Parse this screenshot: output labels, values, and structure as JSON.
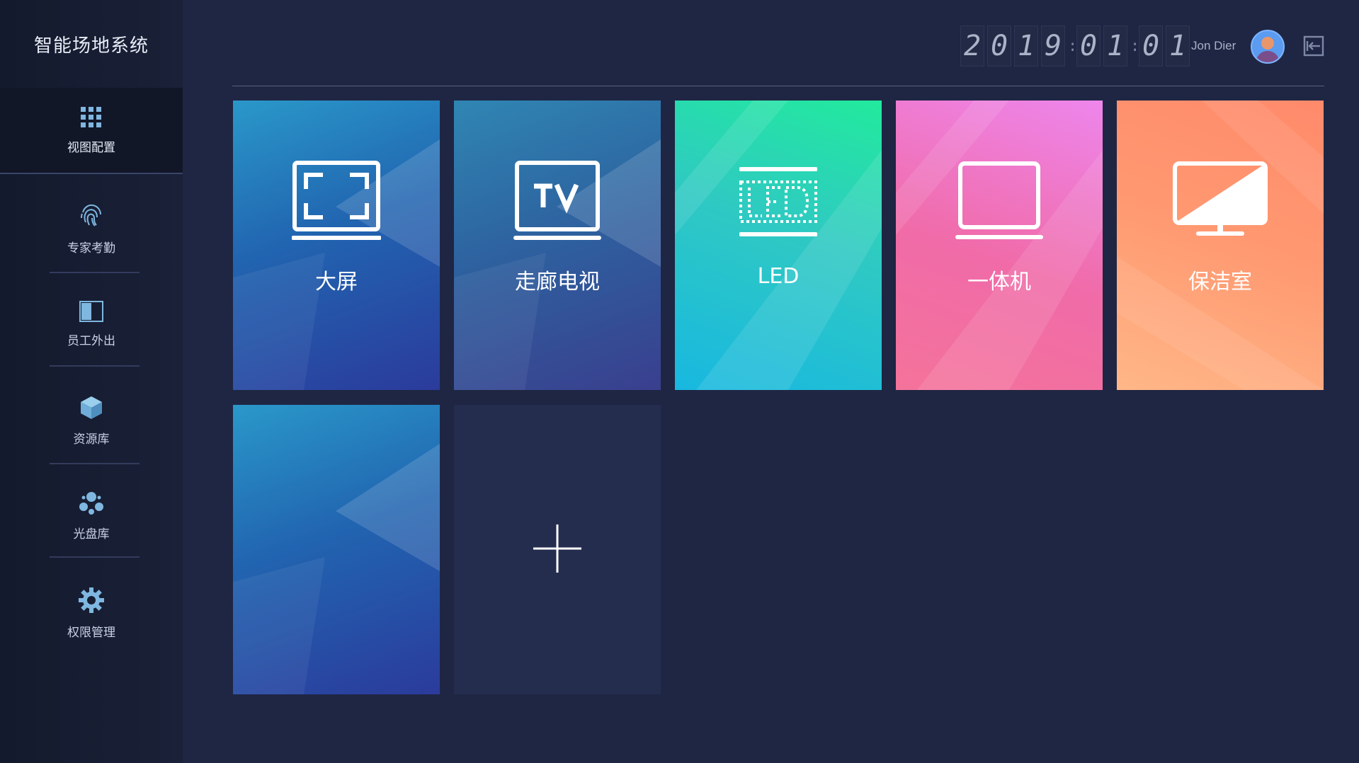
{
  "app": {
    "title": "智能场地系统"
  },
  "sidebar": {
    "items": [
      {
        "label": "视图配置",
        "icon": "grid-icon",
        "active": true
      },
      {
        "label": "专家考勤",
        "icon": "fingerprint-icon"
      },
      {
        "label": "员工外出",
        "icon": "half-square-icon"
      },
      {
        "label": "资源库",
        "icon": "cube-icon"
      },
      {
        "label": "光盘库",
        "icon": "cluster-icon"
      },
      {
        "label": "权限管理",
        "icon": "gear-icon"
      }
    ]
  },
  "header": {
    "clock": [
      "2",
      "0",
      "1",
      "9",
      ":",
      "0",
      "1",
      ":",
      "0",
      "1"
    ],
    "username": "Jon Dier",
    "logout_icon": "logout-icon"
  },
  "tiles": [
    {
      "label": "大屏",
      "icon": "fullscreen-icon",
      "color": "#2164b0"
    },
    {
      "label": "走廊电视",
      "icon": "tv-icon",
      "color": "#2e5f9e"
    },
    {
      "label": "LED",
      "icon": "led-icon",
      "color": "#2fc9c3"
    },
    {
      "label": "一体机",
      "icon": "monitor-icon",
      "color": "#f06ba8"
    },
    {
      "label": "保洁室",
      "icon": "display-icon",
      "color": "#ff9a72"
    },
    {
      "label": "",
      "icon": "",
      "color": "#2164b0"
    },
    {
      "label": "",
      "icon": "plus-icon",
      "color": "#252d4f"
    }
  ]
}
